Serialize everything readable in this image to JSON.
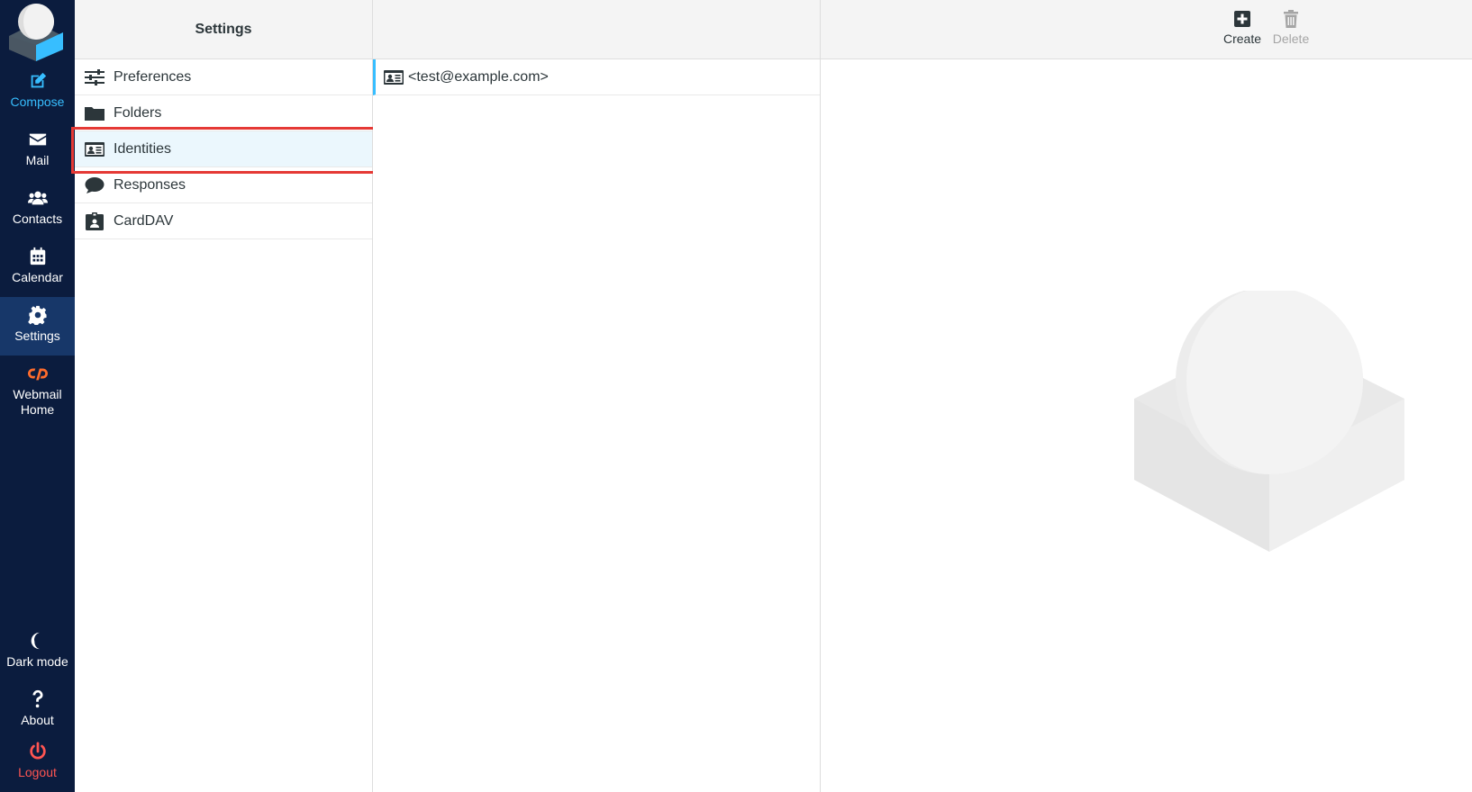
{
  "nav": {
    "items": [
      {
        "label": "Compose",
        "icon": "compose-icon"
      },
      {
        "label": "Mail",
        "icon": "envelope-icon"
      },
      {
        "label": "Contacts",
        "icon": "users-icon"
      },
      {
        "label": "Calendar",
        "icon": "calendar-icon"
      },
      {
        "label": "Settings",
        "icon": "gear-icon"
      },
      {
        "label": "Webmail\nHome",
        "icon": "cpanel-icon"
      }
    ],
    "bottom": [
      {
        "label": "Dark mode",
        "icon": "moon-icon"
      },
      {
        "label": "About",
        "icon": "question-icon"
      },
      {
        "label": "Logout",
        "icon": "power-icon"
      }
    ]
  },
  "settings": {
    "title": "Settings",
    "items": [
      {
        "label": "Preferences",
        "icon": "sliders-icon"
      },
      {
        "label": "Folders",
        "icon": "folder-icon"
      },
      {
        "label": "Identities",
        "icon": "id-card-icon"
      },
      {
        "label": "Responses",
        "icon": "comment-icon"
      },
      {
        "label": "CardDAV",
        "icon": "address-book-icon"
      }
    ],
    "selected": "Identities"
  },
  "identities": {
    "items": [
      {
        "label": "<test@example.com>",
        "icon": "id-card-icon"
      }
    ]
  },
  "toolbar": {
    "create_label": "Create",
    "delete_label": "Delete"
  },
  "colors": {
    "nav_bg": "#0b1c3e",
    "nav_active": "#173769",
    "accent": "#37beff",
    "logout": "#ff5552",
    "highlight": "#e53935"
  }
}
